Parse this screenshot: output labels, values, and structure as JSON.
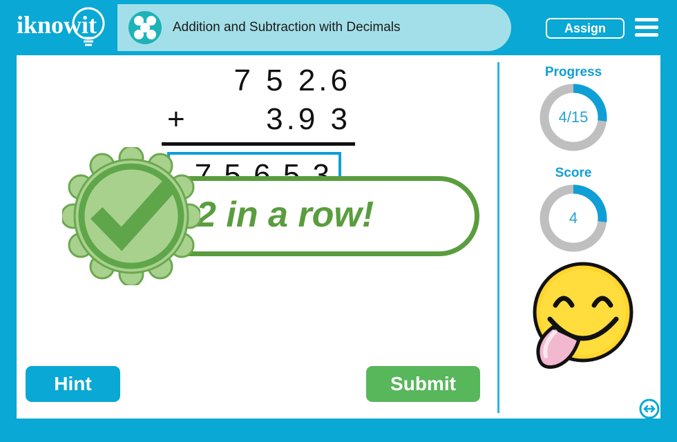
{
  "header": {
    "logo_text": "iknowit",
    "logo_icon": "lightbulb-icon",
    "lesson_icon": "five-dots-icon",
    "title": "Addition and Subtraction with Decimals",
    "assign_label": "Assign",
    "menu_icon": "hamburger-menu-icon",
    "bar_color": "#0aa8d4",
    "pill_color": "#a3dfe8"
  },
  "problem": {
    "addend1": "7 5 2.6",
    "operator": "+",
    "addend2": "3.9 3",
    "answer_value": "7 5 6.5 3",
    "answer_placeholder": "",
    "answer_border_color": "#0f9fd6"
  },
  "feedback": {
    "badge_icon": "check-rosette-icon",
    "streak_text": "2 in a row!",
    "accent_color": "#5a9d3f"
  },
  "sidebar": {
    "progress": {
      "label": "Progress",
      "value_text": "4/15",
      "completed": 4,
      "total": 15,
      "percent": 27
    },
    "score": {
      "label": "Score",
      "value_text": "4",
      "percent": 27
    },
    "reaction_icon": "smiley-tongue-out-icon",
    "next_icon": "double-arrow-circle-icon",
    "accent_color": "#0f9fd6",
    "track_color": "#bfbfbf"
  },
  "footer": {
    "hint_label": "Hint",
    "hint_color": "#0aa8d4",
    "submit_label": "Submit",
    "submit_color": "#58b65b"
  }
}
